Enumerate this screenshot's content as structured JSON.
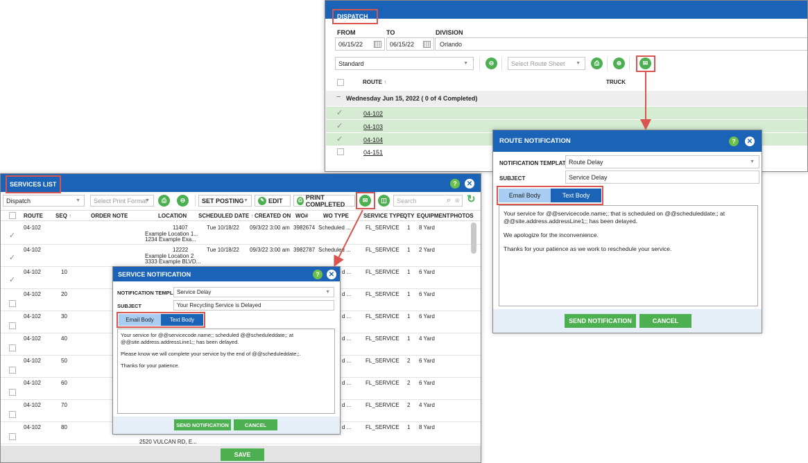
{
  "dispatch": {
    "title": "DISPATCH",
    "from_label": "FROM",
    "to_label": "TO",
    "division_label": "DIVISION",
    "from_value": "06/15/22",
    "to_value": "06/15/22",
    "division_value": "Orlando",
    "view_value": "Standard",
    "route_sheet_placeholder": "Select Route Sheet",
    "col_route": "ROUTE",
    "col_truck": "TRUCK",
    "group_label": "Wednesday Jun 15, 2022 ( 0 of 4 Completed)",
    "routes": [
      "04-102",
      "04-103",
      "04-104",
      "04-151"
    ]
  },
  "route_notification": {
    "title": "ROUTE NOTIFICATION",
    "template_label": "NOTIFICATION TEMPLATE",
    "template_value": "Route Delay",
    "subject_label": "SUBJECT",
    "subject_value": "Service Delay",
    "tab_email": "Email Body",
    "tab_text": "Text Body",
    "body": [
      "Your service for @@servicecode.name;; that is scheduled on @@scheduleddate;; at @@site.address.addressLine1;; has been delayed.",
      "We apologize for the inconvenience.",
      "Thanks for your patience as we work to reschedule your service."
    ],
    "send_label": "SEND NOTIFICATION",
    "cancel_label": "CANCEL"
  },
  "services": {
    "title": "SERVICES LIST",
    "view_value": "Dispatch",
    "print_format_placeholder": "Select Print Format",
    "set_posting_label": "SET POSTING",
    "edit_label": "EDIT",
    "print_completed_label": "PRINT COMPLETED",
    "search_placeholder": "Search",
    "columns": [
      "ROUTE",
      "SEQ",
      "ORDER NOTE",
      "LOCATION",
      "SCHEDULED DATE",
      "CREATED ON",
      "WO#",
      "WO TYPE",
      "SERVICE TYPE",
      "QTY",
      "EQUIPMENT",
      "PHOTOS"
    ],
    "rows": [
      {
        "route": "04-102",
        "seq": "",
        "loc1": "11407",
        "loc2": "Example Location 1...",
        "loc3": "1234 Example Exa...",
        "date": "Tue 10/18/22",
        "created": "09/3/22 3:00 am",
        "wo": "3982674",
        "wotype": "Scheduled ...",
        "stype": "FL_SERVICE",
        "qty": "1",
        "equip": "8 Yard"
      },
      {
        "route": "04-102",
        "seq": "",
        "loc1": "12222",
        "loc2": "Example Location 2",
        "loc3": "3333 Example BLVD...",
        "date": "Tue 10/18/22",
        "created": "09/3/22 3:00 am",
        "wo": "3982787",
        "wotype": "Scheduled ...",
        "stype": "FL_SERVICE",
        "qty": "1",
        "equip": "2 Yard"
      },
      {
        "route": "04-102",
        "seq": "10",
        "wotype": "d ...",
        "stype": "FL_SERVICE",
        "qty": "1",
        "equip": "6 Yard"
      },
      {
        "route": "04-102",
        "seq": "20",
        "wotype": "d ...",
        "stype": "FL_SERVICE",
        "qty": "1",
        "equip": "6 Yard"
      },
      {
        "route": "04-102",
        "seq": "30",
        "wotype": "d ...",
        "stype": "FL_SERVICE",
        "qty": "1",
        "equip": "6 Yard"
      },
      {
        "route": "04-102",
        "seq": "40",
        "wotype": "d ...",
        "stype": "FL_SERVICE",
        "qty": "1",
        "equip": "4 Yard"
      },
      {
        "route": "04-102",
        "seq": "50",
        "wotype": "d ...",
        "stype": "FL_SERVICE",
        "qty": "2",
        "equip": "6 Yard"
      },
      {
        "route": "04-102",
        "seq": "60",
        "wotype": "d ...",
        "stype": "FL_SERVICE",
        "qty": "2",
        "equip": "6 Yard"
      },
      {
        "route": "04-102",
        "seq": "70",
        "wotype": "d ...",
        "stype": "FL_SERVICE",
        "qty": "2",
        "equip": "4 Yard"
      },
      {
        "route": "04-102",
        "seq": "80",
        "wotype": "d ...",
        "stype": "FL_SERVICE",
        "qty": "1",
        "equip": "8 Yard"
      }
    ],
    "last_loc": "2520 VULCAN RD, E...",
    "save_label": "SAVE"
  },
  "service_notification": {
    "title": "SERVICE NOTIFICATION",
    "template_label": "NOTIFICATION TEMPLATE",
    "template_value": "Service Delay",
    "subject_label": "SUBJECT",
    "subject_value": "Your Recycling Service is Delayed",
    "tab_email": "Email Body",
    "tab_text": "Text Body",
    "body": [
      "Your service for @@servicecode.name;; scheduled @@scheduleddate;; at @@site.address.addressLine1;; has been delayed.",
      "Please know we will complete your service by the end of @@scheduleddate;;.",
      "Thanks for your patience."
    ],
    "send_label": "SEND NOTIFICATION",
    "cancel_label": "CANCEL"
  },
  "colors": {
    "header": "#1a63b7",
    "accent_green": "#4caf50",
    "highlight_red": "#d9534f",
    "row_green": "#d5ebd2"
  }
}
